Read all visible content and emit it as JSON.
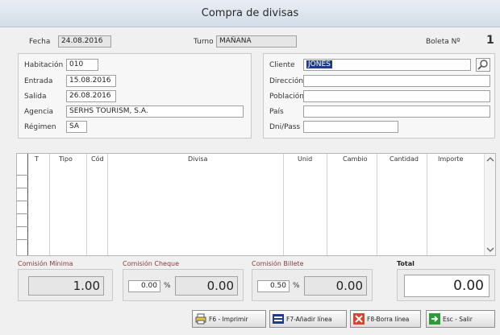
{
  "window": {
    "title": "Compra de divisas"
  },
  "header": {
    "fecha_label": "Fecha",
    "fecha_value": "24.08.2016",
    "turno_label": "Turno",
    "turno_value": "MAÑANA",
    "boleta_label": "Boleta Nº",
    "boleta_value": "1"
  },
  "stay": {
    "habitacion_label": "Habitación",
    "habitacion_value": "010",
    "entrada_label": "Entrada",
    "entrada_value": "15.08.2016",
    "salida_label": "Salida",
    "salida_value": "26.08.2016",
    "agencia_label": "Agencia",
    "agencia_value": "SERHS TOURISM, S.A.",
    "regimen_label": "Régimen",
    "regimen_value": "SA"
  },
  "client": {
    "cliente_label": "Cliente",
    "cliente_value": "JONES",
    "direccion_label": "Dirección",
    "direccion_value": "",
    "poblacion_label": "Población",
    "poblacion_value": "",
    "pais_label": "País",
    "pais_value": "",
    "dni_label": "Dni/Pass",
    "dni_value": "",
    "search_icon": "magnifier-icon"
  },
  "table": {
    "columns": [
      "T",
      "Tipo",
      "Cód",
      "Divisa",
      "Unid",
      "Cambio",
      "Cantidad",
      "Importe"
    ]
  },
  "commissions": {
    "minima_label": "Comisión Mínima",
    "minima_value": "1.00",
    "cheque_label": "Comisión Cheque",
    "cheque_pct": "0.00",
    "cheque_value": "0.00",
    "billete_label": "Comisión Billete",
    "billete_pct": "0.50",
    "billete_value": "0.00",
    "pct_symbol": "%",
    "total_label": "Total",
    "total_value": "0.00"
  },
  "buttons": {
    "print": "F6 - Imprimir",
    "add": "F7-Añadir línea",
    "delete": "F8-Borra línea",
    "exit": "Esc - Salir"
  },
  "colors": {
    "highlight": "#1f3c88",
    "accent": "#8a3a3a"
  }
}
